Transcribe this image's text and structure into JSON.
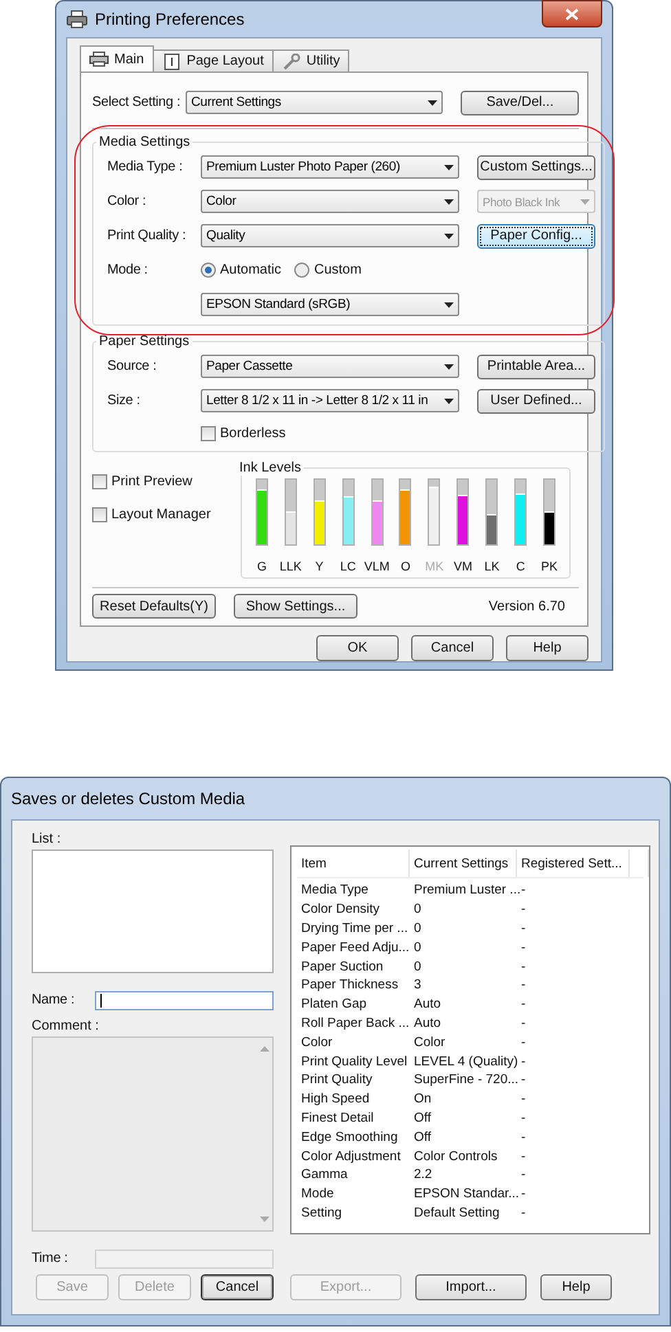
{
  "printing_preferences": {
    "title": "Printing Preferences",
    "tabs": [
      {
        "label": "Main",
        "selected": true
      },
      {
        "label": "Page Layout",
        "selected": false
      },
      {
        "label": "Utility",
        "selected": false
      }
    ],
    "select_setting": {
      "label": "Select Setting :",
      "value": "Current Settings",
      "button": "Save/Del..."
    },
    "media_settings": {
      "title": "Media Settings",
      "highlighted": true,
      "rows": [
        {
          "label": "Media Type :",
          "value": "Premium Luster Photo Paper (260)",
          "side": {
            "kind": "button",
            "label": "Custom Settings...",
            "focused": false
          }
        },
        {
          "label": "Color :",
          "value": "Color",
          "side": {
            "kind": "select",
            "value": "Photo Black Ink",
            "disabled": true
          }
        },
        {
          "label": "Print Quality :",
          "value": "Quality",
          "side": {
            "kind": "button",
            "label": "Paper Config...",
            "focused": true
          }
        }
      ],
      "mode": {
        "label": "Mode :",
        "options": [
          {
            "label": "Automatic",
            "selected": true
          },
          {
            "label": "Custom",
            "selected": false
          }
        ],
        "value": "EPSON Standard (sRGB)"
      }
    },
    "paper_settings": {
      "title": "Paper Settings",
      "rows": [
        {
          "label": "Source :",
          "value": "Paper Cassette",
          "button": "Printable Area..."
        },
        {
          "label": "Size :",
          "value": "Letter 8 1/2 x 11 in -> Letter 8 1/2 x 11 in",
          "button": "User Defined..."
        }
      ],
      "borderless": {
        "label": "Borderless",
        "checked": false
      }
    },
    "options": [
      {
        "label": "Print Preview",
        "checked": false
      },
      {
        "label": "Layout Manager",
        "checked": false
      }
    ],
    "ink_levels": {
      "title": "Ink Levels",
      "inks": [
        {
          "name": "G",
          "color": "#33dd11",
          "level": 0.82,
          "disabled": false
        },
        {
          "name": "LLK",
          "color": "#e4e4e4",
          "level": 0.5,
          "disabled": false
        },
        {
          "name": "Y",
          "color": "#f2ee00",
          "level": 0.67,
          "disabled": false
        },
        {
          "name": "LC",
          "color": "#88eef4",
          "level": 0.72,
          "disabled": false
        },
        {
          "name": "VLM",
          "color": "#ee88ee",
          "level": 0.65,
          "disabled": false
        },
        {
          "name": "O",
          "color": "#f29400",
          "level": 0.82,
          "disabled": false
        },
        {
          "name": "MK",
          "color": "#f0f0f0",
          "level": 0.88,
          "disabled": true
        },
        {
          "name": "VM",
          "color": "#dd11dd",
          "level": 0.74,
          "disabled": false
        },
        {
          "name": "LK",
          "color": "#6e6e6e",
          "level": 0.44,
          "disabled": false
        },
        {
          "name": "C",
          "color": "#11eeee",
          "level": 0.77,
          "disabled": false
        },
        {
          "name": "PK",
          "color": "#000000",
          "level": 0.48,
          "disabled": false
        }
      ]
    },
    "reset_button": "Reset Defaults(Y)",
    "show_settings_button": "Show Settings...",
    "version": "Version 6.70",
    "buttons": [
      "OK",
      "Cancel",
      "Help"
    ]
  },
  "custom_media": {
    "title": "Saves or deletes Custom Media",
    "list_label": "List :",
    "name_label": "Name :",
    "name_focused": true,
    "comment_label": "Comment :",
    "time_label": "Time :",
    "table": {
      "columns": [
        "Item",
        "Current Settings",
        "Registered Sett..."
      ],
      "rows": [
        [
          "Media Type",
          "Premium Luster ...",
          "-"
        ],
        [
          "Color Density",
          "0",
          "-"
        ],
        [
          "Drying Time per ...",
          "0",
          "-"
        ],
        [
          "Paper Feed Adju...",
          "0",
          "-"
        ],
        [
          "Paper Suction",
          "0",
          "-"
        ],
        [
          "Paper Thickness",
          "3",
          "-"
        ],
        [
          "Platen Gap",
          "Auto",
          "-"
        ],
        [
          "Roll Paper Back ...",
          "Auto",
          "-"
        ],
        [
          "Color",
          "Color",
          "-"
        ],
        [
          "Print Quality Level",
          "LEVEL 4 (Quality)",
          "-"
        ],
        [
          "Print Quality",
          "SuperFine - 720...",
          "-"
        ],
        [
          "High Speed",
          "On",
          "-"
        ],
        [
          "Finest Detail",
          "Off",
          "-"
        ],
        [
          "Edge Smoothing",
          "Off",
          "-"
        ],
        [
          "Color Adjustment",
          "Color Controls",
          "-"
        ],
        [
          "Gamma",
          "2.2",
          "-"
        ],
        [
          "Mode",
          "EPSON Standar...",
          "-"
        ],
        [
          "Setting",
          "Default Setting",
          "-"
        ]
      ]
    },
    "left_buttons": [
      {
        "label": "Save",
        "disabled": true,
        "default": false
      },
      {
        "label": "Delete",
        "disabled": true,
        "default": false
      },
      {
        "label": "Cancel",
        "disabled": false,
        "default": true
      }
    ],
    "right_buttons": [
      {
        "label": "Export...",
        "disabled": true,
        "default": false
      },
      {
        "label": "Import...",
        "disabled": false,
        "default": false
      },
      {
        "label": "Help",
        "disabled": false,
        "default": false
      }
    ]
  }
}
